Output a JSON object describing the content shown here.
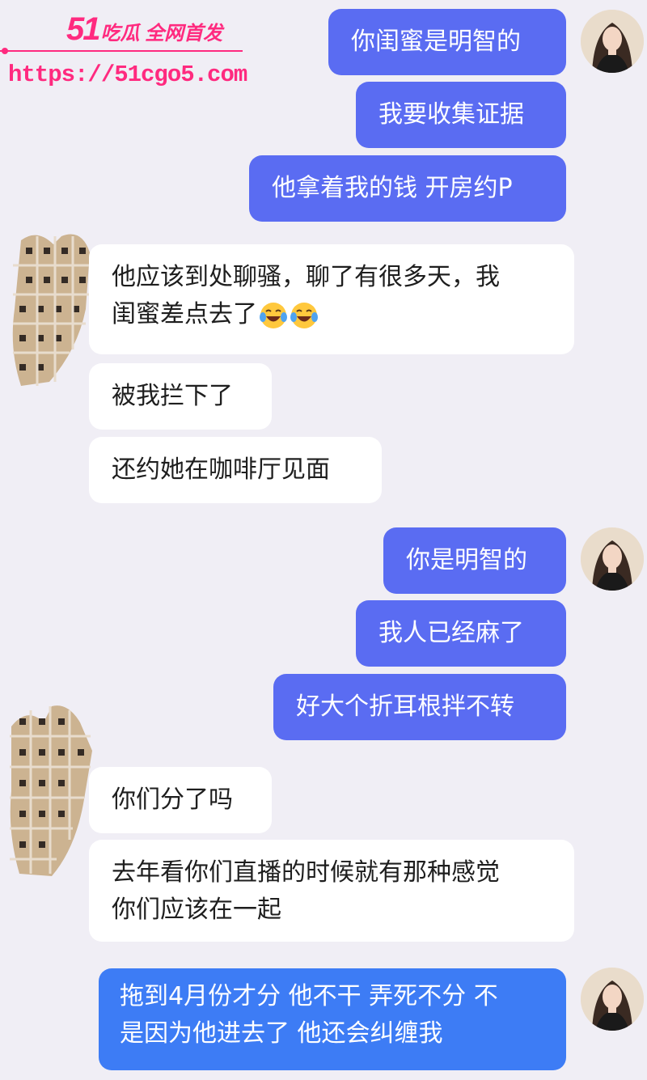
{
  "watermark": {
    "brand_number": "51",
    "brand_text": "吃瓜 全网首发",
    "url": "https://51cgo5.com"
  },
  "messages": [
    {
      "side": "right",
      "text": "你闺蜜是明智的"
    },
    {
      "side": "right",
      "text": "我要收集证据"
    },
    {
      "side": "right",
      "text": "他拿着我的钱 开房约P"
    },
    {
      "side": "left",
      "line1": "他应该到处聊骚，聊了有很多天，我",
      "line2": "闺蜜差点去了",
      "emoji": [
        "crying-laughing-emoji",
        "crying-laughing-emoji"
      ]
    },
    {
      "side": "left",
      "text": "被我拦下了"
    },
    {
      "side": "left",
      "text": "还约她在咖啡厅见面"
    },
    {
      "side": "right",
      "text": "你是明智的"
    },
    {
      "side": "right",
      "text": "我人已经麻了"
    },
    {
      "side": "right",
      "text": "好大个折耳根拌不转"
    },
    {
      "side": "left",
      "text": "你们分了吗"
    },
    {
      "side": "left",
      "line1": "去年看你们直播的时候就有那种感觉",
      "line2": "你们应该在一起"
    },
    {
      "side": "right",
      "line1": "拖到4月份才分 他不干 弄死不分 不",
      "line2": "是因为他进去了 他还会纠缠我"
    }
  ],
  "colors": {
    "background": "#f0eef5",
    "outgoing_bubble": "#5a6cf2",
    "outgoing_bubble_last": "#3d7cf5",
    "incoming_bubble": "#ffffff",
    "watermark": "#ff2a7f"
  }
}
